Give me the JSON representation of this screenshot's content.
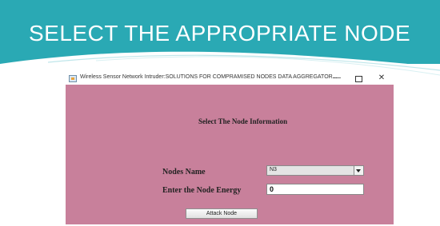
{
  "slide": {
    "title": "SELECT THE APPROPRIATE NODE",
    "accent_color": "#2aa9b4"
  },
  "window": {
    "title": "Wireless Sensor Network Intruder:SOLUTIONS FOR COMPRAMISED NODES DATA AGGREGATOR...",
    "icon": "app-window-icon",
    "controls": {
      "minimize": "—",
      "close": "✕"
    },
    "background_color": "#c8809b"
  },
  "form": {
    "heading": "Select The Node Information",
    "nodes_label": "Nodes Name",
    "nodes_selected": "N3",
    "energy_label": "Enter the Node Energy",
    "energy_value": "0",
    "attack_button": "Attack Node"
  }
}
